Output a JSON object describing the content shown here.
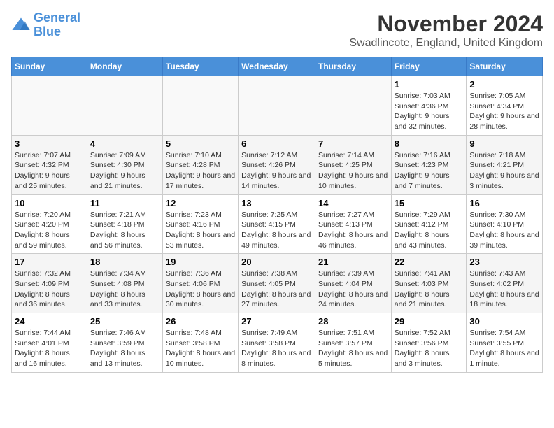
{
  "logo": {
    "line1": "General",
    "line2": "Blue"
  },
  "title": "November 2024",
  "location": "Swadlincote, England, United Kingdom",
  "days_of_week": [
    "Sunday",
    "Monday",
    "Tuesday",
    "Wednesday",
    "Thursday",
    "Friday",
    "Saturday"
  ],
  "weeks": [
    [
      {
        "day": "",
        "info": ""
      },
      {
        "day": "",
        "info": ""
      },
      {
        "day": "",
        "info": ""
      },
      {
        "day": "",
        "info": ""
      },
      {
        "day": "",
        "info": ""
      },
      {
        "day": "1",
        "info": "Sunrise: 7:03 AM\nSunset: 4:36 PM\nDaylight: 9 hours and 32 minutes."
      },
      {
        "day": "2",
        "info": "Sunrise: 7:05 AM\nSunset: 4:34 PM\nDaylight: 9 hours and 28 minutes."
      }
    ],
    [
      {
        "day": "3",
        "info": "Sunrise: 7:07 AM\nSunset: 4:32 PM\nDaylight: 9 hours and 25 minutes."
      },
      {
        "day": "4",
        "info": "Sunrise: 7:09 AM\nSunset: 4:30 PM\nDaylight: 9 hours and 21 minutes."
      },
      {
        "day": "5",
        "info": "Sunrise: 7:10 AM\nSunset: 4:28 PM\nDaylight: 9 hours and 17 minutes."
      },
      {
        "day": "6",
        "info": "Sunrise: 7:12 AM\nSunset: 4:26 PM\nDaylight: 9 hours and 14 minutes."
      },
      {
        "day": "7",
        "info": "Sunrise: 7:14 AM\nSunset: 4:25 PM\nDaylight: 9 hours and 10 minutes."
      },
      {
        "day": "8",
        "info": "Sunrise: 7:16 AM\nSunset: 4:23 PM\nDaylight: 9 hours and 7 minutes."
      },
      {
        "day": "9",
        "info": "Sunrise: 7:18 AM\nSunset: 4:21 PM\nDaylight: 9 hours and 3 minutes."
      }
    ],
    [
      {
        "day": "10",
        "info": "Sunrise: 7:20 AM\nSunset: 4:20 PM\nDaylight: 8 hours and 59 minutes."
      },
      {
        "day": "11",
        "info": "Sunrise: 7:21 AM\nSunset: 4:18 PM\nDaylight: 8 hours and 56 minutes."
      },
      {
        "day": "12",
        "info": "Sunrise: 7:23 AM\nSunset: 4:16 PM\nDaylight: 8 hours and 53 minutes."
      },
      {
        "day": "13",
        "info": "Sunrise: 7:25 AM\nSunset: 4:15 PM\nDaylight: 8 hours and 49 minutes."
      },
      {
        "day": "14",
        "info": "Sunrise: 7:27 AM\nSunset: 4:13 PM\nDaylight: 8 hours and 46 minutes."
      },
      {
        "day": "15",
        "info": "Sunrise: 7:29 AM\nSunset: 4:12 PM\nDaylight: 8 hours and 43 minutes."
      },
      {
        "day": "16",
        "info": "Sunrise: 7:30 AM\nSunset: 4:10 PM\nDaylight: 8 hours and 39 minutes."
      }
    ],
    [
      {
        "day": "17",
        "info": "Sunrise: 7:32 AM\nSunset: 4:09 PM\nDaylight: 8 hours and 36 minutes."
      },
      {
        "day": "18",
        "info": "Sunrise: 7:34 AM\nSunset: 4:08 PM\nDaylight: 8 hours and 33 minutes."
      },
      {
        "day": "19",
        "info": "Sunrise: 7:36 AM\nSunset: 4:06 PM\nDaylight: 8 hours and 30 minutes."
      },
      {
        "day": "20",
        "info": "Sunrise: 7:38 AM\nSunset: 4:05 PM\nDaylight: 8 hours and 27 minutes."
      },
      {
        "day": "21",
        "info": "Sunrise: 7:39 AM\nSunset: 4:04 PM\nDaylight: 8 hours and 24 minutes."
      },
      {
        "day": "22",
        "info": "Sunrise: 7:41 AM\nSunset: 4:03 PM\nDaylight: 8 hours and 21 minutes."
      },
      {
        "day": "23",
        "info": "Sunrise: 7:43 AM\nSunset: 4:02 PM\nDaylight: 8 hours and 18 minutes."
      }
    ],
    [
      {
        "day": "24",
        "info": "Sunrise: 7:44 AM\nSunset: 4:01 PM\nDaylight: 8 hours and 16 minutes."
      },
      {
        "day": "25",
        "info": "Sunrise: 7:46 AM\nSunset: 3:59 PM\nDaylight: 8 hours and 13 minutes."
      },
      {
        "day": "26",
        "info": "Sunrise: 7:48 AM\nSunset: 3:58 PM\nDaylight: 8 hours and 10 minutes."
      },
      {
        "day": "27",
        "info": "Sunrise: 7:49 AM\nSunset: 3:58 PM\nDaylight: 8 hours and 8 minutes."
      },
      {
        "day": "28",
        "info": "Sunrise: 7:51 AM\nSunset: 3:57 PM\nDaylight: 8 hours and 5 minutes."
      },
      {
        "day": "29",
        "info": "Sunrise: 7:52 AM\nSunset: 3:56 PM\nDaylight: 8 hours and 3 minutes."
      },
      {
        "day": "30",
        "info": "Sunrise: 7:54 AM\nSunset: 3:55 PM\nDaylight: 8 hours and 1 minute."
      }
    ]
  ]
}
